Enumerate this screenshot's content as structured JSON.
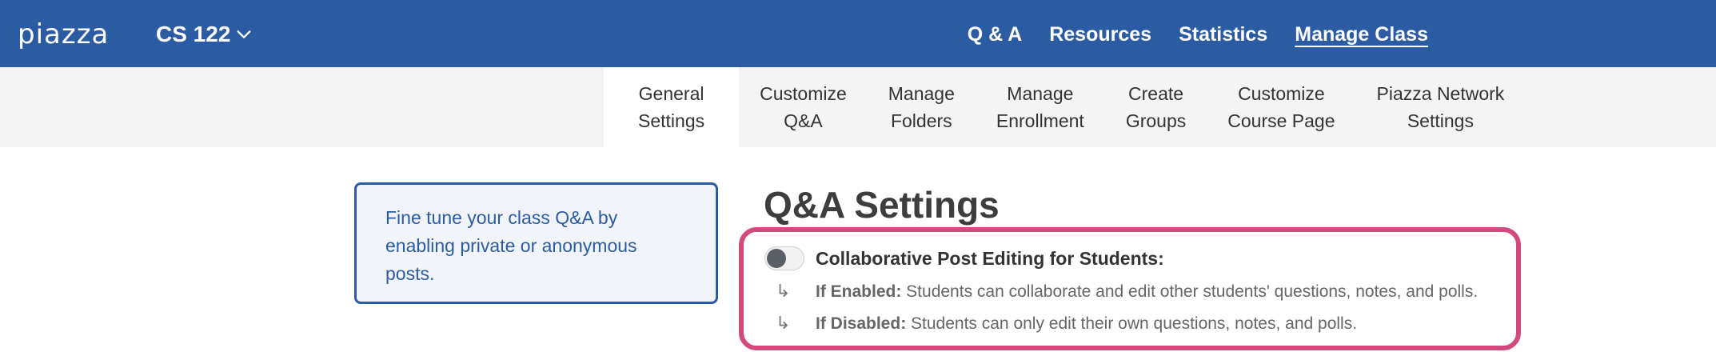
{
  "header": {
    "logo": "piazza",
    "course": "CS 122",
    "nav": [
      {
        "label": "Q & A",
        "active": false
      },
      {
        "label": "Resources",
        "active": false
      },
      {
        "label": "Statistics",
        "active": false
      },
      {
        "label": "Manage Class",
        "active": true
      }
    ],
    "bar_color": "#2b5ba3"
  },
  "subnav": {
    "tabs": [
      {
        "label": "General\nSettings",
        "active": true
      },
      {
        "label": "Customize\nQ&A",
        "active": false
      },
      {
        "label": "Manage\nFolders",
        "active": false
      },
      {
        "label": "Manage\nEnrollment",
        "active": false
      },
      {
        "label": "Create\nGroups",
        "active": false
      },
      {
        "label": "Customize\nCourse Page",
        "active": false
      },
      {
        "label": "Piazza Network\nSettings",
        "active": false
      }
    ]
  },
  "tip": {
    "text": "Fine tune your class Q&A by enabling private or anonymous posts."
  },
  "main": {
    "title": "Q&A Settings",
    "option": {
      "label": "Collaborative Post Editing for Students:",
      "enabled": false,
      "if_enabled_label": "If Enabled:",
      "if_enabled_text": " Students can collaborate and edit other students' questions, notes, and polls.",
      "if_disabled_label": "If Disabled:",
      "if_disabled_text": " Students can only edit their own questions, notes, and polls."
    },
    "highlight_color": "#d14a7d"
  }
}
